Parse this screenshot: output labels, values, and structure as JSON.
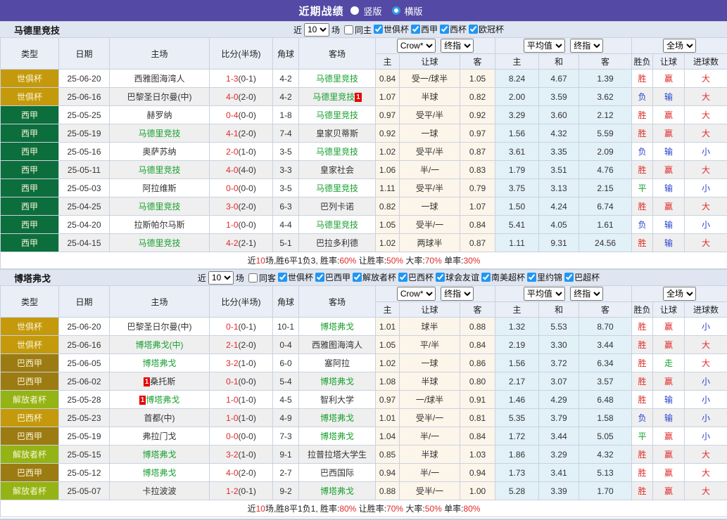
{
  "topbar": {
    "title": "近期战绩",
    "vertical": "竖版",
    "horizontal": "横版"
  },
  "controls": {
    "near": "近",
    "count": "10",
    "games": "场"
  },
  "selects": {
    "crow": "Crow*",
    "final": "终指",
    "avg": "平均值",
    "scope": "全场"
  },
  "cols": {
    "type": "类型",
    "date": "日期",
    "home": "主场",
    "score": "比分(半场)",
    "corner": "角球",
    "away": "客场",
    "h_home": "主",
    "h_handicap": "让球",
    "h_away": "客",
    "e_home": "主",
    "e_draw": "和",
    "e_away": "客",
    "r_result": "胜负",
    "r_handicap": "让球",
    "r_goals": "进球数"
  },
  "sections": [
    {
      "team": "马德里竞技",
      "same_label": "同主",
      "leagues": [
        "世俱杯",
        "西甲",
        "西杯",
        "欧冠杯"
      ],
      "rows": [
        {
          "lg": "世俱杯",
          "dt": "25-06-20",
          "hm": {
            "n": "西雅图海湾人"
          },
          "sc": "1-3",
          "hf": "(0-1)",
          "cn": "4-2",
          "aw": {
            "n": "马德里竞技",
            "g": 1
          },
          "c1": "0.84",
          "hd": "受一/球半",
          "c2": "1.05",
          "e1": "8.24",
          "e2": "4.67",
          "e3": "1.39",
          "rs": "胜",
          "hr": "赢",
          "gl": "大"
        },
        {
          "lg": "世俱杯",
          "dt": "25-06-16",
          "hm": {
            "n": "巴黎圣日尔曼(中)"
          },
          "sc": "4-0",
          "hf": "(2-0)",
          "cn": "4-2",
          "aw": {
            "n": "马德里竞技",
            "g": 1,
            "rc": "1",
            "rp": "suf"
          },
          "c1": "1.07",
          "hd": "半球",
          "c2": "0.82",
          "e1": "2.00",
          "e2": "3.59",
          "e3": "3.62",
          "rs": "负",
          "hr": "输",
          "gl": "大"
        },
        {
          "lg": "西甲",
          "dt": "25-05-25",
          "hm": {
            "n": "赫罗纳"
          },
          "sc": "0-4",
          "hf": "(0-0)",
          "cn": "1-8",
          "aw": {
            "n": "马德里竞技",
            "g": 1
          },
          "c1": "0.97",
          "hd": "受平/半",
          "c2": "0.92",
          "e1": "3.29",
          "e2": "3.60",
          "e3": "2.12",
          "rs": "胜",
          "hr": "赢",
          "gl": "大"
        },
        {
          "lg": "西甲",
          "dt": "25-05-19",
          "hm": {
            "n": "马德里竞技",
            "g": 1
          },
          "sc": "4-1",
          "hf": "(2-0)",
          "cn": "7-4",
          "aw": {
            "n": "皇家贝蒂斯"
          },
          "c1": "0.92",
          "hd": "一球",
          "c2": "0.97",
          "e1": "1.56",
          "e2": "4.32",
          "e3": "5.59",
          "rs": "胜",
          "hr": "赢",
          "gl": "大"
        },
        {
          "lg": "西甲",
          "dt": "25-05-16",
          "hm": {
            "n": "奥萨苏纳"
          },
          "sc": "2-0",
          "hf": "(1-0)",
          "cn": "3-5",
          "aw": {
            "n": "马德里竞技",
            "g": 1
          },
          "c1": "1.02",
          "hd": "受平/半",
          "c2": "0.87",
          "e1": "3.61",
          "e2": "3.35",
          "e3": "2.09",
          "rs": "负",
          "hr": "输",
          "gl": "小"
        },
        {
          "lg": "西甲",
          "dt": "25-05-11",
          "hm": {
            "n": "马德里竞技",
            "g": 1
          },
          "sc": "4-0",
          "hf": "(4-0)",
          "cn": "3-3",
          "aw": {
            "n": "皇家社会"
          },
          "c1": "1.06",
          "hd": "半/一",
          "c2": "0.83",
          "e1": "1.79",
          "e2": "3.51",
          "e3": "4.76",
          "rs": "胜",
          "hr": "赢",
          "gl": "大"
        },
        {
          "lg": "西甲",
          "dt": "25-05-03",
          "hm": {
            "n": "阿拉维斯"
          },
          "sc": "0-0",
          "hf": "(0-0)",
          "cn": "3-5",
          "aw": {
            "n": "马德里竞技",
            "g": 1
          },
          "c1": "1.11",
          "hd": "受平/半",
          "c2": "0.79",
          "e1": "3.75",
          "e2": "3.13",
          "e3": "2.15",
          "rs": "平",
          "hr": "输",
          "gl": "小"
        },
        {
          "lg": "西甲",
          "dt": "25-04-25",
          "hm": {
            "n": "马德里竞技",
            "g": 1
          },
          "sc": "3-0",
          "hf": "(2-0)",
          "cn": "6-3",
          "aw": {
            "n": "巴列卡诺"
          },
          "c1": "0.82",
          "hd": "一球",
          "c2": "1.07",
          "e1": "1.50",
          "e2": "4.24",
          "e3": "6.74",
          "rs": "胜",
          "hr": "赢",
          "gl": "大"
        },
        {
          "lg": "西甲",
          "dt": "25-04-20",
          "hm": {
            "n": "拉斯帕尔马斯"
          },
          "sc": "1-0",
          "hf": "(0-0)",
          "cn": "4-4",
          "aw": {
            "n": "马德里竞技",
            "g": 1
          },
          "c1": "1.05",
          "hd": "受半/一",
          "c2": "0.84",
          "e1": "5.41",
          "e2": "4.05",
          "e3": "1.61",
          "rs": "负",
          "hr": "输",
          "gl": "小"
        },
        {
          "lg": "西甲",
          "dt": "25-04-15",
          "hm": {
            "n": "马德里竞技",
            "g": 1
          },
          "sc": "4-2",
          "hf": "(2-1)",
          "cn": "5-1",
          "aw": {
            "n": "巴拉多利德"
          },
          "c1": "1.02",
          "hd": "两球半",
          "c2": "0.87",
          "e1": "1.11",
          "e2": "9.31",
          "e3": "24.56",
          "rs": "胜",
          "hr": "输",
          "gl": "大"
        }
      ],
      "summary": [
        {
          "t": "近"
        },
        {
          "t": "10",
          "r": 1
        },
        {
          "t": "场,胜6平1负3, 胜率:"
        },
        {
          "t": "60%",
          "r": 1
        },
        {
          "t": " 让胜率:"
        },
        {
          "t": "50%",
          "r": 1
        },
        {
          "t": " 大率:"
        },
        {
          "t": "70%",
          "r": 1
        },
        {
          "t": " 单率:"
        },
        {
          "t": "30%",
          "r": 1
        }
      ]
    },
    {
      "team": "博塔弗戈",
      "same_label": "同客",
      "leagues": [
        "世俱杯",
        "巴西甲",
        "解放者杯",
        "巴西杯",
        "球会友谊",
        "南美超杯",
        "里约锦",
        "巴超杯"
      ],
      "rows": [
        {
          "lg": "世俱杯",
          "dt": "25-06-20",
          "hm": {
            "n": "巴黎圣日尔曼(中)"
          },
          "sc": "0-1",
          "hf": "(0-1)",
          "cn": "10-1",
          "aw": {
            "n": "博塔弗戈",
            "g": 1
          },
          "c1": "1.01",
          "hd": "球半",
          "c2": "0.88",
          "e1": "1.32",
          "e2": "5.53",
          "e3": "8.70",
          "rs": "胜",
          "hr": "赢",
          "gl": "小"
        },
        {
          "lg": "世俱杯",
          "dt": "25-06-16",
          "hm": {
            "n": "博塔弗戈(中)",
            "g": 1
          },
          "sc": "2-1",
          "hf": "(2-0)",
          "cn": "0-4",
          "aw": {
            "n": "西雅图海湾人"
          },
          "c1": "1.05",
          "hd": "平/半",
          "c2": "0.84",
          "e1": "2.19",
          "e2": "3.30",
          "e3": "3.44",
          "rs": "胜",
          "hr": "赢",
          "gl": "大"
        },
        {
          "lg": "巴西甲",
          "dt": "25-06-05",
          "hm": {
            "n": "博塔弗戈",
            "g": 1
          },
          "sc": "3-2",
          "hf": "(1-0)",
          "cn": "6-0",
          "aw": {
            "n": "塞阿拉"
          },
          "c1": "1.02",
          "hd": "一球",
          "c2": "0.86",
          "e1": "1.56",
          "e2": "3.72",
          "e3": "6.34",
          "rs": "胜",
          "hr": "走",
          "gl": "大"
        },
        {
          "lg": "巴西甲",
          "dt": "25-06-02",
          "hm": {
            "n": "桑托斯",
            "rc": "1",
            "rp": "pre"
          },
          "sc": "0-1",
          "hf": "(0-0)",
          "cn": "5-4",
          "aw": {
            "n": "博塔弗戈",
            "g": 1
          },
          "c1": "1.08",
          "hd": "半球",
          "c2": "0.80",
          "e1": "2.17",
          "e2": "3.07",
          "e3": "3.57",
          "rs": "胜",
          "hr": "赢",
          "gl": "小"
        },
        {
          "lg": "解放者杯",
          "dt": "25-05-28",
          "hm": {
            "n": "博塔弗戈",
            "g": 1,
            "rc": "1",
            "rp": "pre"
          },
          "sc": "1-0",
          "hf": "(1-0)",
          "cn": "4-5",
          "aw": {
            "n": "智利大学"
          },
          "c1": "0.97",
          "hd": "一/球半",
          "c2": "0.91",
          "e1": "1.46",
          "e2": "4.29",
          "e3": "6.48",
          "rs": "胜",
          "hr": "输",
          "gl": "小"
        },
        {
          "lg": "巴西杯",
          "dt": "25-05-23",
          "hm": {
            "n": "首都(中)"
          },
          "sc": "1-0",
          "hf": "(1-0)",
          "cn": "4-9",
          "aw": {
            "n": "博塔弗戈",
            "g": 1
          },
          "c1": "1.01",
          "hd": "受半/一",
          "c2": "0.81",
          "e1": "5.35",
          "e2": "3.79",
          "e3": "1.58",
          "rs": "负",
          "hr": "输",
          "gl": "小"
        },
        {
          "lg": "巴西甲",
          "dt": "25-05-19",
          "hm": {
            "n": "弗拉门戈"
          },
          "sc": "0-0",
          "hf": "(0-0)",
          "cn": "7-3",
          "aw": {
            "n": "博塔弗戈",
            "g": 1
          },
          "c1": "1.04",
          "hd": "半/一",
          "c2": "0.84",
          "e1": "1.72",
          "e2": "3.44",
          "e3": "5.05",
          "rs": "平",
          "hr": "赢",
          "gl": "小"
        },
        {
          "lg": "解放者杯",
          "dt": "25-05-15",
          "hm": {
            "n": "博塔弗戈",
            "g": 1
          },
          "sc": "3-2",
          "hf": "(1-0)",
          "cn": "9-1",
          "aw": {
            "n": "拉普拉塔大学生"
          },
          "c1": "0.85",
          "hd": "半球",
          "c2": "1.03",
          "e1": "1.86",
          "e2": "3.29",
          "e3": "4.32",
          "rs": "胜",
          "hr": "赢",
          "gl": "大"
        },
        {
          "lg": "巴西甲",
          "dt": "25-05-12",
          "hm": {
            "n": "博塔弗戈",
            "g": 1
          },
          "sc": "4-0",
          "hf": "(2-0)",
          "cn": "2-7",
          "aw": {
            "n": "巴西国际"
          },
          "c1": "0.94",
          "hd": "半/一",
          "c2": "0.94",
          "e1": "1.73",
          "e2": "3.41",
          "e3": "5.13",
          "rs": "胜",
          "hr": "赢",
          "gl": "大"
        },
        {
          "lg": "解放者杯",
          "dt": "25-05-07",
          "hm": {
            "n": "卡拉波波"
          },
          "sc": "1-2",
          "hf": "(0-1)",
          "cn": "9-2",
          "aw": {
            "n": "博塔弗戈",
            "g": 1
          },
          "c1": "0.88",
          "hd": "受半/一",
          "c2": "1.00",
          "e1": "5.28",
          "e2": "3.39",
          "e3": "1.70",
          "rs": "胜",
          "hr": "赢",
          "gl": "大"
        }
      ],
      "summary": [
        {
          "t": "近"
        },
        {
          "t": "10",
          "r": 1
        },
        {
          "t": "场,胜8平1负1, 胜率:"
        },
        {
          "t": "80%",
          "r": 1
        },
        {
          "t": " 让胜率:"
        },
        {
          "t": "70%",
          "r": 1
        },
        {
          "t": " 大率:"
        },
        {
          "t": "50%",
          "r": 1
        },
        {
          "t": " 单率:"
        },
        {
          "t": "80%",
          "r": 1
        }
      ]
    }
  ]
}
